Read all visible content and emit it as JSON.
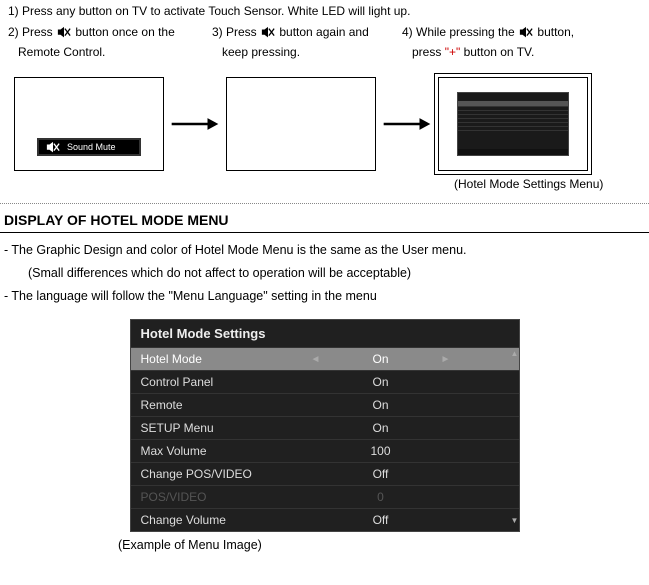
{
  "steps": {
    "s1": "1) Press any button on TV to activate Touch Sensor.   White LED will light up.",
    "s2a": "2) Press ",
    "s2b": " button once on the",
    "s2c": "Remote Control.",
    "s3a": "3) Press ",
    "s3b": " button again and",
    "s3c": "keep pressing.",
    "s4a": "4) While pressing the ",
    "s4b": " button,",
    "s4c_pre": "press ",
    "s4c_plus": "\"+\"",
    "s4c_post": " button on TV."
  },
  "diagram": {
    "sound_mute_label": "Sound Mute",
    "caption": "(Hotel Mode Settings Menu)"
  },
  "section_title": "DISPLAY OF HOTEL MODE MENU",
  "body": {
    "l1": "- The Graphic Design and color of Hotel Mode Menu is the same as the User menu.",
    "l2": "(Small differences which do not affect to operation will be acceptable)",
    "l3": "- The language will follow the \"Menu Language\" setting in the menu"
  },
  "menu": {
    "title": "Hotel Mode Settings",
    "rows": [
      {
        "k": "Hotel Mode",
        "v": "On",
        "sel": true
      },
      {
        "k": "Control Panel",
        "v": "On"
      },
      {
        "k": "Remote",
        "v": "On"
      },
      {
        "k": "SETUP Menu",
        "v": "On"
      },
      {
        "k": "Max Volume",
        "v": "100"
      },
      {
        "k": "Change POS/VIDEO",
        "v": "Off"
      },
      {
        "k": "POS/VIDEO",
        "v": "0",
        "dim": true
      },
      {
        "k": "Change Volume",
        "v": "Off"
      }
    ],
    "arrow_left": "◄",
    "arrow_right": "►",
    "scroll_up": "▲",
    "scroll_down": "▼"
  },
  "example_caption": "(Example of Menu Image)"
}
